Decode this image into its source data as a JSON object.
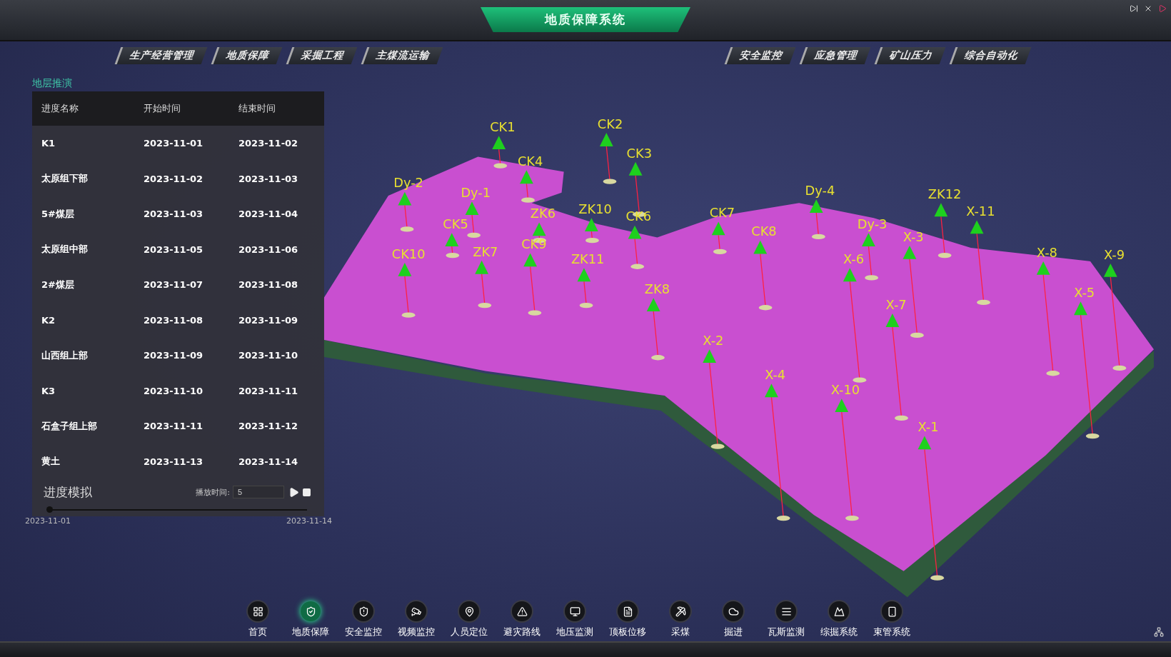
{
  "window": {
    "title": "地质保障系统"
  },
  "nav_left": [
    "生产经营管理",
    "地质保障",
    "采掘工程",
    "主煤流运输"
  ],
  "nav_right": [
    "安全监控",
    "应急管理",
    "矿山压力",
    "综合自动化"
  ],
  "panel": {
    "title": "地层推演",
    "columns": [
      "进度名称",
      "开始时间",
      "结束时间"
    ],
    "rows": [
      [
        "K1",
        "2023-11-01",
        "2023-11-02"
      ],
      [
        "太原组下部",
        "2023-11-02",
        "2023-11-03"
      ],
      [
        "5#煤层",
        "2023-11-03",
        "2023-11-04"
      ],
      [
        "太原组中部",
        "2023-11-05",
        "2023-11-06"
      ],
      [
        "2#煤层",
        "2023-11-07",
        "2023-11-08"
      ],
      [
        "K2",
        "2023-11-08",
        "2023-11-09"
      ],
      [
        "山西组上部",
        "2023-11-09",
        "2023-11-10"
      ],
      [
        "K3",
        "2023-11-10",
        "2023-11-11"
      ],
      [
        "石盒子组上部",
        "2023-11-11",
        "2023-11-12"
      ],
      [
        "黄土",
        "2023-11-13",
        "2023-11-14"
      ]
    ],
    "simulation": {
      "label": "进度模拟",
      "play_time_label": "播放时间:",
      "play_time_value": "5",
      "progress": {
        "level": 0
      },
      "start_date": "2023-11-01",
      "end_date": "2023-11-14"
    }
  },
  "scene": {
    "wells": [
      {
        "label": "CK1"
      },
      {
        "label": "CK2"
      },
      {
        "label": "CK3"
      },
      {
        "label": "CK4"
      },
      {
        "label": "Dy-2"
      },
      {
        "label": "Dy-1"
      },
      {
        "label": "CK5"
      },
      {
        "label": "ZK6"
      },
      {
        "label": "ZK10"
      },
      {
        "label": "CK6"
      },
      {
        "label": "CK10"
      },
      {
        "label": "ZK7"
      },
      {
        "label": "CK9"
      },
      {
        "label": "ZK11"
      },
      {
        "label": "ZK8"
      },
      {
        "label": "CK7"
      },
      {
        "label": "CK8"
      },
      {
        "label": "Dy-4"
      },
      {
        "label": "Dy-3"
      },
      {
        "label": "ZK12"
      },
      {
        "label": "X-11"
      },
      {
        "label": "X-3"
      },
      {
        "label": "X-6"
      },
      {
        "label": "X-8"
      },
      {
        "label": "X-9"
      },
      {
        "label": "X-7"
      },
      {
        "label": "X-5"
      },
      {
        "label": "X-2"
      },
      {
        "label": "X-4"
      },
      {
        "label": "X-10"
      },
      {
        "label": "X-1"
      }
    ]
  },
  "dock": [
    {
      "label": "首页",
      "selected": false
    },
    {
      "label": "地质保障",
      "selected": true
    },
    {
      "label": "安全监控",
      "selected": false
    },
    {
      "label": "视频监控",
      "selected": false
    },
    {
      "label": "人员定位",
      "selected": false
    },
    {
      "label": "避灾路线",
      "selected": false
    },
    {
      "label": "地压监测",
      "selected": false
    },
    {
      "label": "顶板位移",
      "selected": false
    },
    {
      "label": "采煤",
      "selected": false
    },
    {
      "label": "掘进",
      "selected": false
    },
    {
      "label": "瓦斯监测",
      "selected": false
    },
    {
      "label": "综掘系统",
      "selected": false
    },
    {
      "label": "束管系统",
      "selected": false
    }
  ]
}
